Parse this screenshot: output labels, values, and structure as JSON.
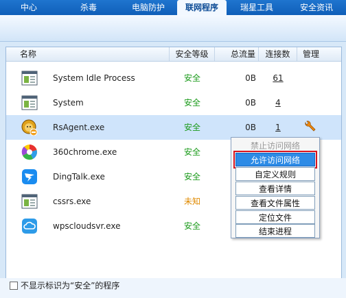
{
  "nav": {
    "tabs": [
      {
        "label": "中心"
      },
      {
        "label": "杀毒"
      },
      {
        "label": "电脑防护"
      },
      {
        "label": "联网程序",
        "active": true
      },
      {
        "label": "瑞星工具"
      },
      {
        "label": "安全资讯"
      }
    ]
  },
  "table": {
    "headers": {
      "name": "名称",
      "level": "安全等级",
      "flow": "总流量",
      "conn": "连接数",
      "manage": "管理"
    },
    "rows": [
      {
        "name": "System Idle Process",
        "level": "安全",
        "flow": "0B",
        "conn": "61",
        "icon": "window-app-icon"
      },
      {
        "name": "System",
        "level": "安全",
        "flow": "0B",
        "conn": "4",
        "icon": "window-app-icon"
      },
      {
        "name": "RsAgent.exe",
        "level": "安全",
        "flow": "0B",
        "conn": "1",
        "icon": "rising-lion-icon",
        "selected": true
      },
      {
        "name": "360chrome.exe",
        "level": "安全",
        "flow": "",
        "conn": "",
        "icon": "360-chrome-icon"
      },
      {
        "name": "DingTalk.exe",
        "level": "安全",
        "flow": "",
        "conn": "",
        "icon": "dingtalk-icon"
      },
      {
        "name": "cssrs.exe",
        "level": "未知",
        "flow": "",
        "conn": "",
        "icon": "window-app-icon"
      },
      {
        "name": "wpscloudsvr.exe",
        "level": "安全",
        "flow": "",
        "conn": "",
        "icon": "wps-cloud-icon"
      }
    ]
  },
  "context_menu": {
    "items": [
      "禁止访问网络",
      "允许访问网络",
      "自定义规则",
      "查看详情",
      "查看文件属性",
      "定位文件",
      "结束进程"
    ]
  },
  "footer": {
    "label": "不显示标识为“安全”的程序"
  },
  "colors": {
    "safe": "#1a9a1a",
    "unknown": "#e08a00",
    "highlight": "#2d8be6",
    "highlight_border": "#d8141e"
  }
}
